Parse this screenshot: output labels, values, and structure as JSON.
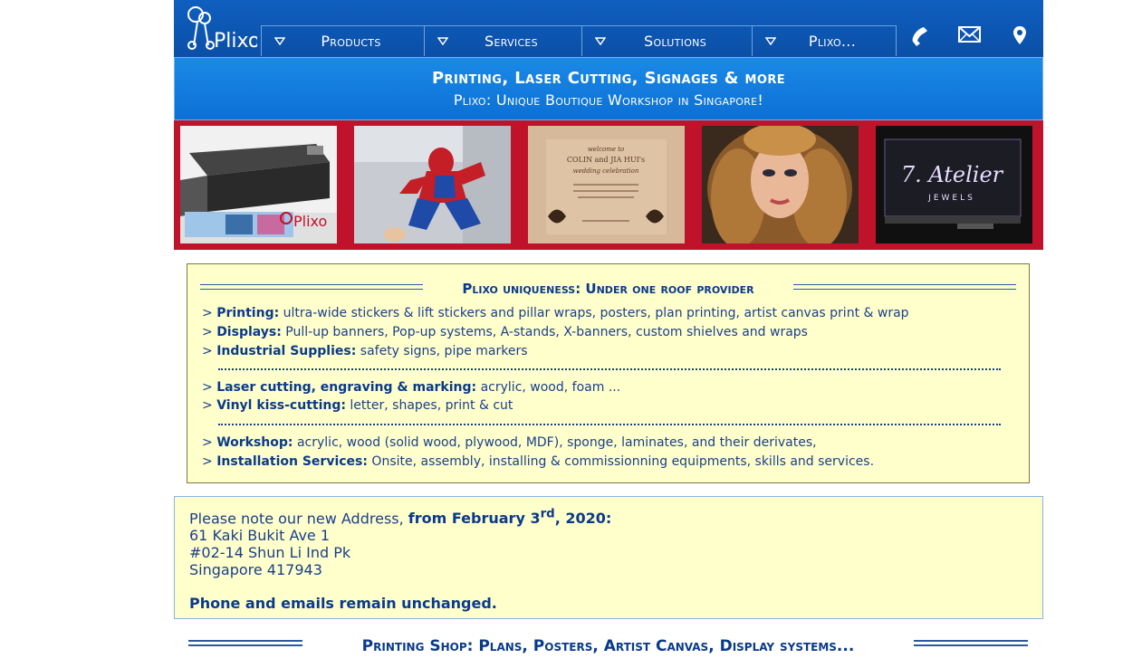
{
  "nav": {
    "logo_text": "Plixo",
    "items": [
      {
        "label": "Products"
      },
      {
        "label": "Services"
      },
      {
        "label": "Solutions"
      },
      {
        "label": "Plixo..."
      }
    ],
    "icons": [
      "phone-icon",
      "mail-icon",
      "location-icon"
    ]
  },
  "tagline": {
    "line1": "Printing, Laser Cutting, Signages & more",
    "line2": "Plixo: Unique Boutique Workshop in Singapore!"
  },
  "gallery": {
    "photos": [
      "printer-photo",
      "spiderman-cutout-photo",
      "wedding-engraving-photo",
      "portrait-canvas-photo",
      "acrylic-sign-photo"
    ],
    "photo1_watermark": "Plixo",
    "photo3_text": [
      "welcome to",
      "COLIN and JIA HUI's",
      "wedding celebration"
    ],
    "photo5_text": {
      "line1": "7. Atelier",
      "line2": "JEWELS"
    }
  },
  "uniqueness": {
    "heading": "Plixo uniqueness: Under one roof provider",
    "items": [
      {
        "title": "Printing:",
        "text": "ultra-wide stickers & lift stickers and pillar wraps, posters, plan printing, artist canvas print & wrap"
      },
      {
        "title": "Displays:",
        "text": "Pull-up banners, Pop-up systems, A-stands, X-banners, custom shielves and wraps"
      },
      {
        "title": "Industrial Supplies:",
        "text": "safety signs, pipe markers"
      },
      {
        "title": "Laser cutting, engraving & marking:",
        "text": "acrylic, wood, foam ..."
      },
      {
        "title": "Vinyl kiss-cutting:",
        "text": "letter, shapes, print & cut"
      },
      {
        "title": "Workshop:",
        "text": "acrylic, wood (solid wood, plywood, MDF), sponge, laminates, and their derivates,"
      },
      {
        "title": "Installation Services:",
        "text": "Onsite, assembly, installing & commissionning equipments, skills and services."
      }
    ],
    "bullet": ">"
  },
  "address": {
    "intro": "Please note our new Address,",
    "date_prefix": "from February 3",
    "date_sup": "rd",
    "date_suffix": ", 2020:",
    "line1": "61 Kaki Bukit Ave 1",
    "line2": "#02-14 Shun Li Ind Pk",
    "line3": "Singapore 417943",
    "note": "Phone and emails remain unchanged."
  },
  "section_heading": "Printing Shop: Plans, Posters, Artist Canvas, Display systems...",
  "colors": {
    "nav_blue": "#0b4fa6",
    "tagline_blue": "#1a8ae6",
    "gallery_red": "#c0122b",
    "box_yellow": "#ffffcc",
    "text_blue": "#0a3a8a"
  }
}
